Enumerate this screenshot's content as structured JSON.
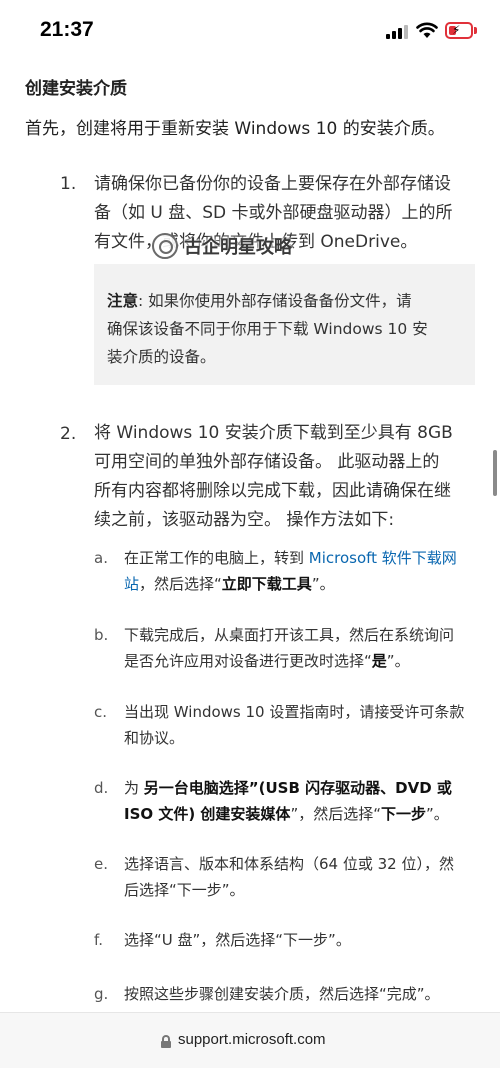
{
  "status_bar": {
    "time": "21:37",
    "icons": [
      "signal-icon",
      "wifi-icon",
      "battery-charging-icon"
    ],
    "battery_color": "#e0313a"
  },
  "article": {
    "heading": "创建安装介质",
    "intro": "首先，创建将用于重新安装 Windows 10 的安装介质。",
    "steps": [
      {
        "number": "1.",
        "lines": [
          "请确保你已备份你的设备上要保存在外部存储设",
          "备（如 U 盘、SD 卡或外部硬盘驱动器）上的所",
          "有文件，或将你的文件上传到 OneDrive。"
        ]
      },
      {
        "number": "2.",
        "lines": [
          "将 Windows 10 安装介质下载到至少具有 8GB",
          "可用空间的单独外部存储设备。 此驱动器上的",
          "所有内容都将删除以完成下载，因此请确保在继",
          "续之前，该驱动器为空。 操作方法如下:"
        ]
      }
    ],
    "note": {
      "label": "注意",
      "line1": ": 如果你使用外部存储设备备份文件，请",
      "line2": "确保该设备不同于你用于下载 Windows 10 安",
      "line3": "装介质的设备。"
    },
    "watermark": "古企明星攻略",
    "substeps": {
      "a": {
        "letter": "a.",
        "pre": "在正常工作的电脑上，转到 ",
        "link1": "Microsoft 软件下载网",
        "link2": "站",
        "mid": "，然后选择“",
        "bold": "立即下载工具",
        "post": "”。"
      },
      "b": {
        "letter": "b.",
        "line1": "下载完成后，从桌面打开该工具，然后在系统询问",
        "line2_pre": "是否允许应用对设备进行更改时选择“",
        "bold": "是",
        "line2_post": "”。"
      },
      "c": {
        "letter": "c.",
        "line1": "当出现 Windows 10 设置指南时，请接受许可条款",
        "line2": "和协议。"
      },
      "d": {
        "letter": "d.",
        "pre": "为 ",
        "bold1": "另一台电脑选择”(USB 闪存驱动器、DVD 或",
        "bold2": "ISO 文件) 创建安装媒体",
        "mid": "”，然后选择“",
        "bold3": "下一步",
        "post": "”。"
      },
      "e": {
        "letter": "e.",
        "line1": "选择语言、版本和体系结构（64 位或 32 位），然",
        "line2": "后选择“下一步”。"
      },
      "f": {
        "letter": "f.",
        "line1": "选择“U 盘”，然后选择“下一步”。"
      },
      "g": {
        "letter": "g.",
        "line1": "按照这些步骤创建安装介质，然后选择“完成”。"
      }
    },
    "link_color": "#0a67b0"
  },
  "browser": {
    "url": "support.microsoft.com",
    "icon": "lock-icon"
  }
}
